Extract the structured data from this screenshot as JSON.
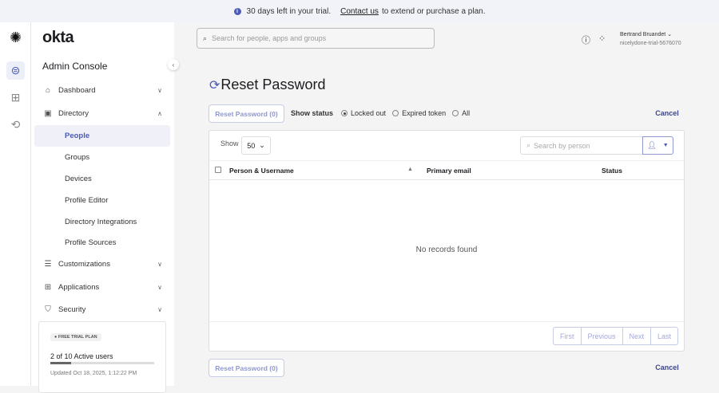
{
  "banner": {
    "text": "30 days left in your trial.",
    "link": "Contact us",
    "rest": "to extend or purchase a plan."
  },
  "brand": {
    "logo": "okta",
    "console": "Admin Console"
  },
  "nav": [
    {
      "label": "Dashboard",
      "icon": "home-icon",
      "chev": "⌄"
    },
    {
      "label": "Directory",
      "icon": "directory-icon",
      "chev": "⌃"
    },
    {
      "label": "People",
      "active": true
    },
    {
      "label": "Groups"
    },
    {
      "label": "Devices"
    },
    {
      "label": "Profile Editor"
    },
    {
      "label": "Directory Integrations"
    },
    {
      "label": "Profile Sources"
    },
    {
      "label": "Customizations",
      "icon": "customizations-icon",
      "chev": "⌄"
    },
    {
      "label": "Applications",
      "icon": "applications-icon",
      "chev": "⌄"
    },
    {
      "label": "Security",
      "icon": "shield-icon",
      "chev": "⌄"
    }
  ],
  "trial": {
    "badge": "FREE TRIAL PLAN",
    "users": "2 of 10 Active users",
    "progress": 0.2,
    "updated": "Updated Oct 18, 2025, 1:12:22 PM"
  },
  "search": {
    "placeholder": "Search for people, apps and groups"
  },
  "user": {
    "name": "Bertrand Bruandet",
    "org": "nicelydone-trial-5676070"
  },
  "page": {
    "title": "Reset Password",
    "reset_button": "Reset Password (0)",
    "cancel": "Cancel",
    "show_status": "Show status",
    "statuses": [
      "Locked out",
      "Expired token",
      "All"
    ],
    "selected_status": "Locked out"
  },
  "table": {
    "show_label": "Show",
    "page_size": "50",
    "search_placeholder": "Search by person",
    "columns": [
      "Person & Username",
      "Primary email",
      "Status"
    ],
    "empty": "No records found",
    "pager": [
      "First",
      "Previous",
      "Next",
      "Last"
    ]
  }
}
